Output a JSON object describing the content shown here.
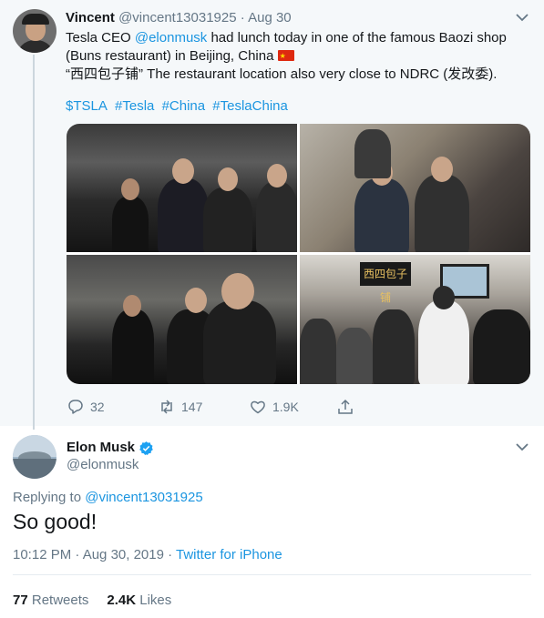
{
  "parent_tweet": {
    "author_name": "Vincent",
    "author_handle": "@vincent13031925",
    "separator": "·",
    "date": "Aug 30",
    "text_before_mention": "Tesla CEO ",
    "mention": "@elonmusk",
    "text_line1_rest": " had lunch today in one of the famous Baozi shop",
    "text_line2": "(Buns restaurant) in Beijing, China ",
    "text_line3": "“西四包子铺” The restaurant location also very close to NDRC (发改委).",
    "hashtags": [
      "$TSLA",
      "#Tesla",
      "#China",
      "#TeslaChina"
    ],
    "photo_sign_text": "西四包子铺",
    "stats": {
      "replies": "32",
      "retweets": "147",
      "likes": "1.9K"
    }
  },
  "main_tweet": {
    "author_name": "Elon Musk",
    "author_handle": "@elonmusk",
    "verified": true,
    "replying_prefix": "Replying to ",
    "replying_to": "@vincent13031925",
    "text": "So good!",
    "time": "10:12 PM · Aug 30, 2019",
    "time_separator": " · ",
    "source": "Twitter for iPhone",
    "retweets_count": "77",
    "retweets_label": "Retweets",
    "likes_count": "2.4K",
    "likes_label": "Likes"
  },
  "colors": {
    "link": "#1b95e0",
    "muted": "#657786",
    "text": "#14171a",
    "verified": "#1da1f2",
    "parent_bg": "#f5f8fa"
  },
  "icons": {
    "reply": "reply-icon",
    "retweet": "retweet-icon",
    "like": "like-icon",
    "share": "share-icon",
    "caret": "chevron-down-icon",
    "verified": "verified-badge-icon",
    "flag": "china-flag-icon"
  }
}
